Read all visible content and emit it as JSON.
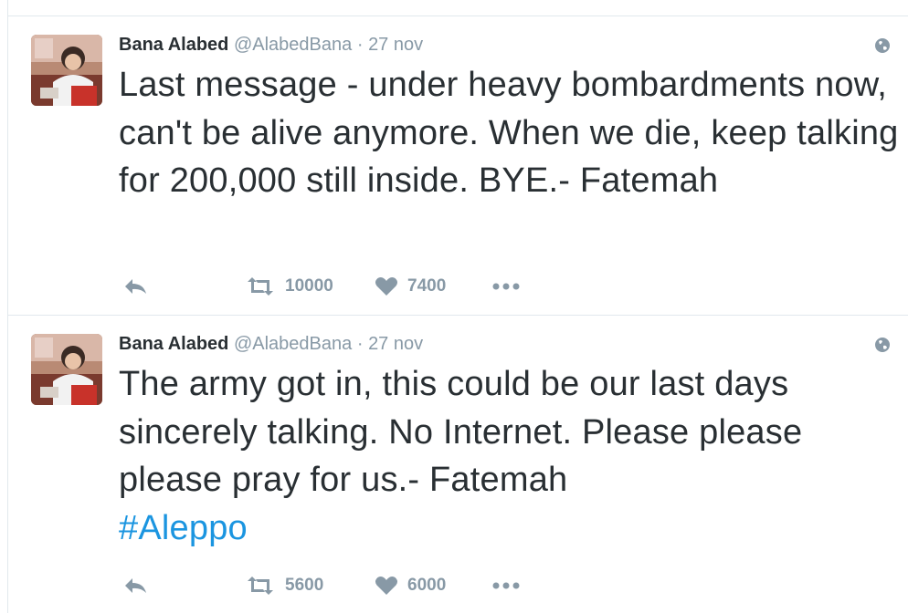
{
  "tweets": [
    {
      "author_name": "Bana Alabed",
      "handle": "@AlabedBana",
      "separator": "·",
      "time": "27 nov",
      "text": "Last message - under heavy bombardments now, can't be alive anymore. When we die, keep talking for 200,000 still inside. BYE.- Fatemah",
      "hashtag": "",
      "retweets": "10000",
      "likes": "7400",
      "icons": {
        "reply": "reply-icon",
        "retweet": "retweet-icon",
        "like": "heart-icon",
        "more": "more-icon",
        "globe": "globe-icon"
      }
    },
    {
      "author_name": "Bana Alabed",
      "handle": "@AlabedBana",
      "separator": "·",
      "time": "27 nov",
      "text": "The army got in, this could be our last days sincerely talking. No Internet. Please please please pray for us.- Fatemah",
      "hashtag": "#Aleppo",
      "retweets": "5600",
      "likes": "6000",
      "icons": {
        "reply": "reply-icon",
        "retweet": "retweet-icon",
        "like": "heart-icon",
        "more": "more-icon",
        "globe": "globe-icon"
      }
    }
  ],
  "colors": {
    "text": "#292f33",
    "secondary": "#8899a6",
    "link": "#1b95e0",
    "border": "#e1e8ed"
  }
}
